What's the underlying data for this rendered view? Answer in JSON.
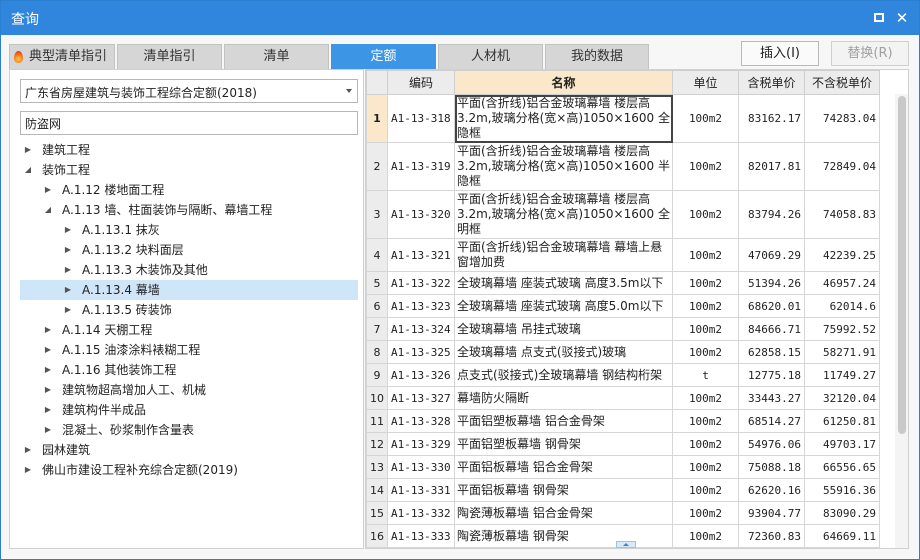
{
  "window": {
    "title": "查询",
    "maximize": "maximize",
    "close": "✕"
  },
  "tabs": [
    {
      "label": "典型清单指引"
    },
    {
      "label": "清单指引"
    },
    {
      "label": "清单"
    },
    {
      "label": "定额"
    },
    {
      "label": "人材机"
    },
    {
      "label": "我的数据"
    }
  ],
  "actions": {
    "insert": "插入(I)",
    "replace": "替换(R)"
  },
  "left": {
    "dropdown_value": "广东省房屋建筑与装饰工程综合定额(2018)",
    "search_value": "防盗网"
  },
  "tree": [
    {
      "label": "建筑工程",
      "toggle": "▶"
    },
    {
      "label": "装饰工程",
      "toggle": "◢"
    },
    {
      "label": "A.1.12 楼地面工程",
      "toggle": "▶"
    },
    {
      "label": "A.1.13 墙、柱面装饰与隔断、幕墙工程",
      "toggle": "◢"
    },
    {
      "label": "A.1.13.1 抹灰",
      "toggle": "▶"
    },
    {
      "label": "A.1.13.2 块料面层",
      "toggle": "▶"
    },
    {
      "label": "A.1.13.3 木装饰及其他",
      "toggle": "▶"
    },
    {
      "label": "A.1.13.4 幕墙",
      "toggle": "▶"
    },
    {
      "label": "A.1.13.5 砖装饰",
      "toggle": "▶"
    },
    {
      "label": "A.1.14 天棚工程",
      "toggle": "▶"
    },
    {
      "label": "A.1.15 油漆涂料裱糊工程",
      "toggle": "▶"
    },
    {
      "label": "A.1.16 其他装饰工程",
      "toggle": "▶"
    },
    {
      "label": "建筑物超高增加人工、机械",
      "toggle": "▶"
    },
    {
      "label": "建筑构件半成品",
      "toggle": "▶"
    },
    {
      "label": "混凝土、砂浆制作含量表",
      "toggle": "▶"
    },
    {
      "label": "园林建筑",
      "toggle": "▶"
    },
    {
      "label": "佛山市建设工程补充综合定额(2019)",
      "toggle": "▶"
    }
  ],
  "grid": {
    "headers": [
      "",
      "编码",
      "名称",
      "单位",
      "含税单价",
      "不含税单价"
    ],
    "rows": [
      {
        "idx": "1",
        "code": "A1-13-318",
        "name": "平面(含折线)铝合金玻璃幕墙 楼层高3.2m,玻璃分格(宽×高)1050×1600 全隐框",
        "unit": "100m2",
        "tax": "83162.17",
        "notax": "74283.04"
      },
      {
        "idx": "2",
        "code": "A1-13-319",
        "name": "平面(含折线)铝合金玻璃幕墙 楼层高3.2m,玻璃分格(宽×高)1050×1600 半隐框",
        "unit": "100m2",
        "tax": "82017.81",
        "notax": "72849.04"
      },
      {
        "idx": "3",
        "code": "A1-13-320",
        "name": "平面(含折线)铝合金玻璃幕墙 楼层高3.2m,玻璃分格(宽×高)1050×1600 全明框",
        "unit": "100m2",
        "tax": "83794.26",
        "notax": "74058.83"
      },
      {
        "idx": "4",
        "code": "A1-13-321",
        "name": "平面(含折线)铝合金玻璃幕墙 幕墙上悬窗增加费",
        "unit": "100m2",
        "tax": "47069.29",
        "notax": "42239.25"
      },
      {
        "idx": "5",
        "code": "A1-13-322",
        "name": "全玻璃幕墙 座装式玻璃 高度3.5m以下",
        "unit": "100m2",
        "tax": "51394.26",
        "notax": "46957.24"
      },
      {
        "idx": "6",
        "code": "A1-13-323",
        "name": "全玻璃幕墙 座装式玻璃 高度5.0m以下",
        "unit": "100m2",
        "tax": "68620.01",
        "notax": "62014.6"
      },
      {
        "idx": "7",
        "code": "A1-13-324",
        "name": "全玻璃幕墙 吊挂式玻璃",
        "unit": "100m2",
        "tax": "84666.71",
        "notax": "75992.52"
      },
      {
        "idx": "8",
        "code": "A1-13-325",
        "name": "全玻璃幕墙 点支式(驳接式)玻璃",
        "unit": "100m2",
        "tax": "62858.15",
        "notax": "58271.91"
      },
      {
        "idx": "9",
        "code": "A1-13-326",
        "name": "点支式(驳接式)全玻璃幕墙 钢结构桁架",
        "unit": "t",
        "tax": "12775.18",
        "notax": "11749.27"
      },
      {
        "idx": "10",
        "code": "A1-13-327",
        "name": "幕墙防火隔断",
        "unit": "100m2",
        "tax": "33443.27",
        "notax": "32120.04"
      },
      {
        "idx": "11",
        "code": "A1-13-328",
        "name": "平面铝塑板幕墙 铝合金骨架",
        "unit": "100m2",
        "tax": "68514.27",
        "notax": "61250.81"
      },
      {
        "idx": "12",
        "code": "A1-13-329",
        "name": "平面铝塑板幕墙 钢骨架",
        "unit": "100m2",
        "tax": "54976.06",
        "notax": "49703.17"
      },
      {
        "idx": "13",
        "code": "A1-13-330",
        "name": "平面铝板幕墙 铝合金骨架",
        "unit": "100m2",
        "tax": "75088.18",
        "notax": "66556.65"
      },
      {
        "idx": "14",
        "code": "A1-13-331",
        "name": "平面铝板幕墙 钢骨架",
        "unit": "100m2",
        "tax": "62620.16",
        "notax": "55916.36"
      },
      {
        "idx": "15",
        "code": "A1-13-332",
        "name": "陶瓷薄板幕墙 铝合金骨架",
        "unit": "100m2",
        "tax": "93904.77",
        "notax": "83090.29"
      },
      {
        "idx": "16",
        "code": "A1-13-333",
        "name": "陶瓷薄板幕墙 钢骨架",
        "unit": "100m2",
        "tax": "72360.83",
        "notax": "64669.11"
      }
    ]
  },
  "colors": {
    "titlebar": "#2f86dc",
    "active_tab": "#3d95e6",
    "header_highlight": "#fbe7c9",
    "selected_node": "#cfe5f8"
  }
}
